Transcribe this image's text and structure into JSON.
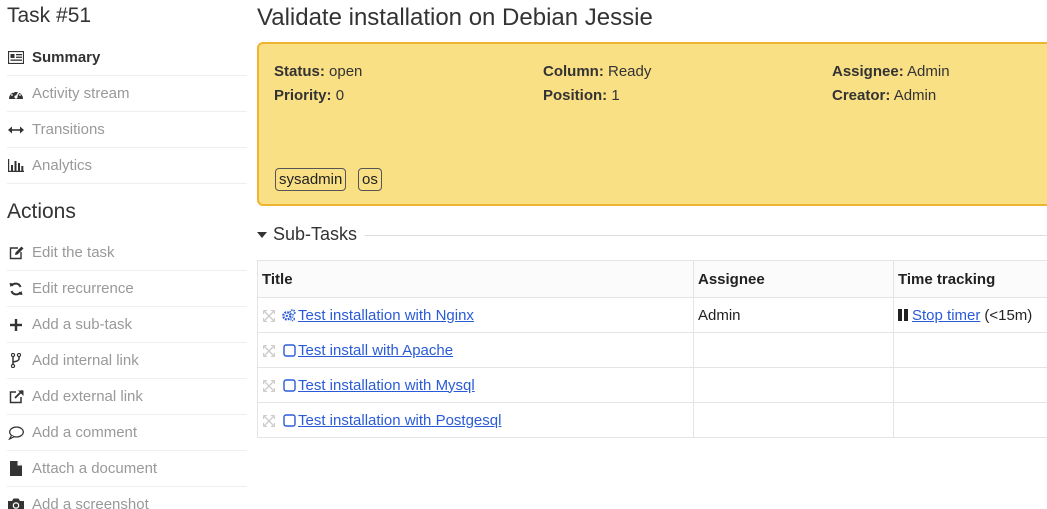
{
  "task": {
    "id_label": "Task #51",
    "title": "Validate installation on Debian Jessie"
  },
  "sidebar": {
    "nav": [
      {
        "label": "Summary",
        "icon": "newspaper-icon",
        "active": true
      },
      {
        "label": "Activity stream",
        "icon": "dashboard-icon"
      },
      {
        "label": "Transitions",
        "icon": "arrows-h-icon"
      },
      {
        "label": "Analytics",
        "icon": "bar-chart-icon"
      }
    ],
    "actions_heading": "Actions",
    "actions": [
      {
        "label": "Edit the task",
        "icon": "edit-icon"
      },
      {
        "label": "Edit recurrence",
        "icon": "refresh-icon"
      },
      {
        "label": "Add a sub-task",
        "icon": "plus-icon"
      },
      {
        "label": "Add internal link",
        "icon": "code-fork-icon"
      },
      {
        "label": "Add external link",
        "icon": "external-link-icon"
      },
      {
        "label": "Add a comment",
        "icon": "comment-icon"
      },
      {
        "label": "Attach a document",
        "icon": "file-icon"
      },
      {
        "label": "Add a screenshot",
        "icon": "camera-icon"
      }
    ]
  },
  "summary": {
    "status_label": "Status:",
    "status_value": "open",
    "priority_label": "Priority:",
    "priority_value": "0",
    "column_label": "Column:",
    "column_value": "Ready",
    "position_label": "Position:",
    "position_value": "1",
    "assignee_label": "Assignee:",
    "assignee_value": "Admin",
    "creator_label": "Creator:",
    "creator_value": "Admin",
    "tags": [
      "sysadmin",
      "os"
    ],
    "colors": {
      "background": "#f9e085",
      "border": "#f0b433"
    }
  },
  "subtasks": {
    "heading": "Sub-Tasks",
    "columns": [
      "Title",
      "Assignee",
      "Time tracking"
    ],
    "rows": [
      {
        "title": "Test installation with Nginx",
        "status": "in-progress",
        "assignee": "Admin",
        "timer_link": "Stop timer",
        "timer_note": "(<15m)"
      },
      {
        "title": "Test install with Apache",
        "status": "todo",
        "assignee": "",
        "timer_link": "",
        "timer_note": ""
      },
      {
        "title": "Test installation with Mysql",
        "status": "todo",
        "assignee": "",
        "timer_link": "",
        "timer_note": ""
      },
      {
        "title": "Test installation with Postgesql",
        "status": "todo",
        "assignee": "",
        "timer_link": "",
        "timer_note": ""
      }
    ],
    "link_color": "#2a5bd7"
  }
}
